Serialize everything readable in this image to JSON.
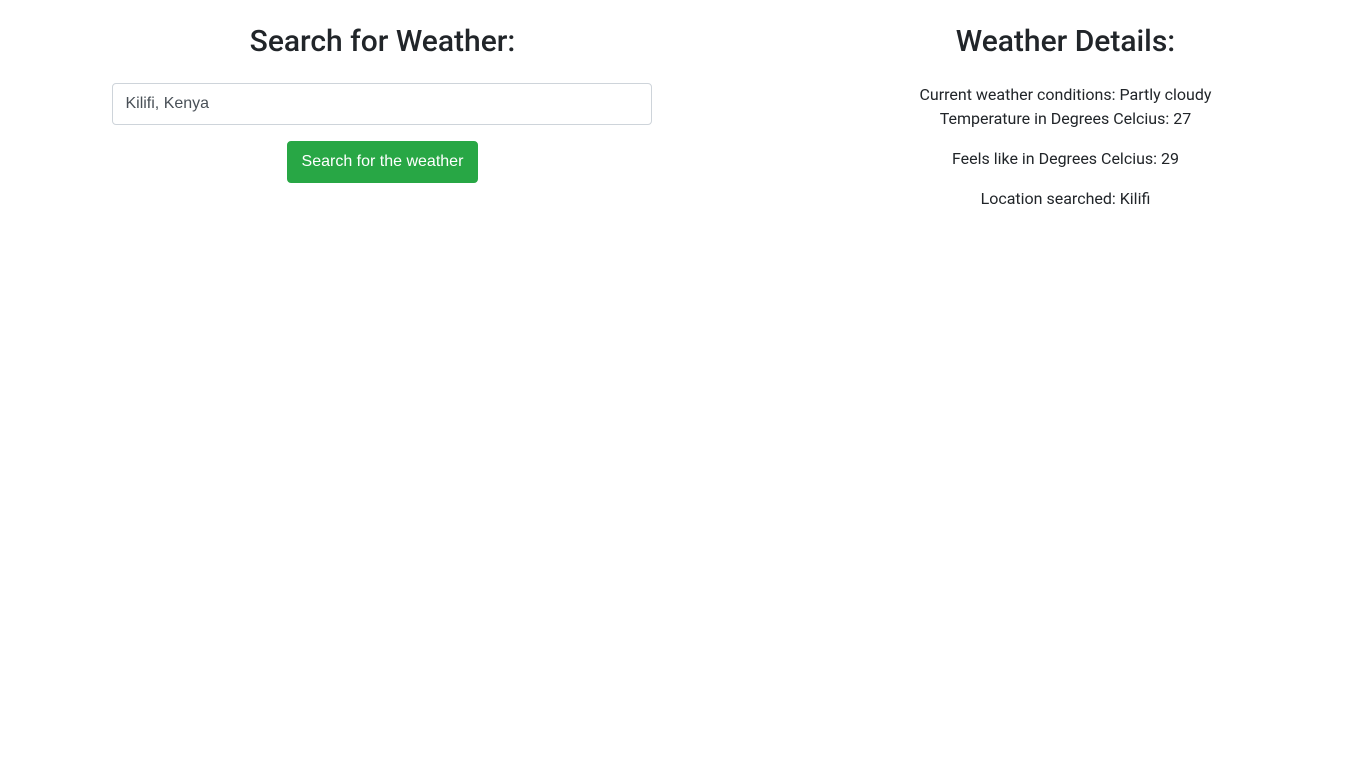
{
  "search": {
    "heading": "Search for Weather:",
    "input_value": "Kilifi, Kenya",
    "button_label": "Search for the weather"
  },
  "details": {
    "heading": "Weather Details:",
    "conditions_line": "Current weather conditions: Partly cloudy",
    "temperature_line": "Temperature in Degrees Celcius: 27",
    "feels_like_line": "Feels like in Degrees Celcius: 29",
    "location_line": "Location searched: Kilifi"
  }
}
